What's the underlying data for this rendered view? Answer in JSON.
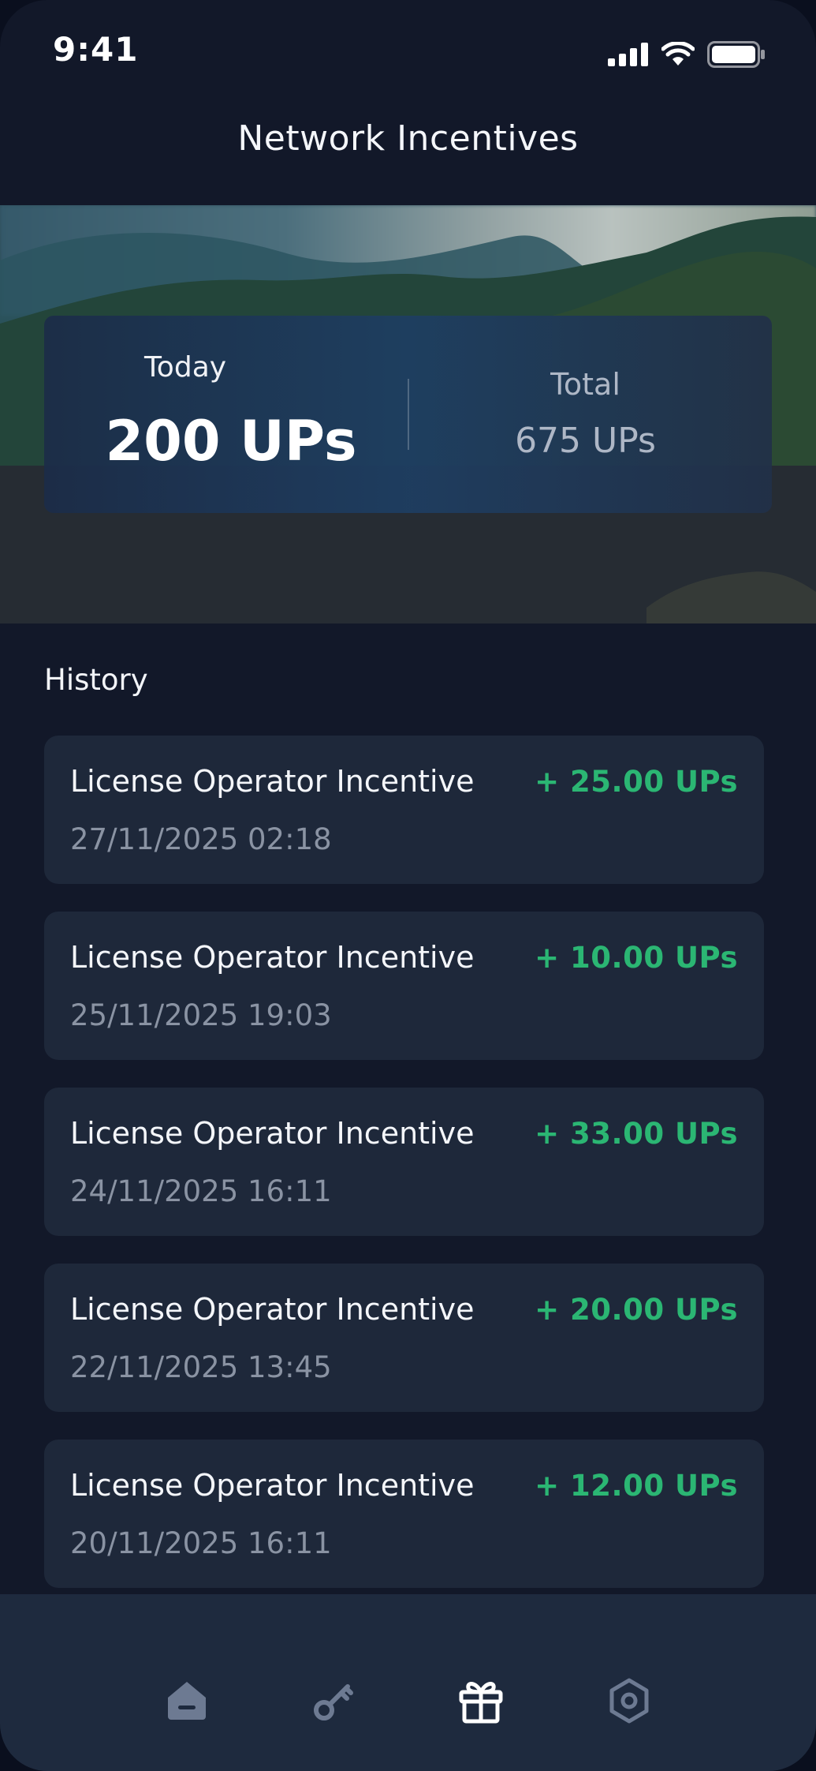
{
  "status_bar": {
    "time": "9:41",
    "icons": [
      "cellular-signal-icon",
      "wifi-icon",
      "battery-icon"
    ]
  },
  "header": {
    "title": "Network Incentives"
  },
  "stats": {
    "today_label": "Today",
    "today_value": "200 UPs",
    "total_label": "Total",
    "total_value": "675 UPs"
  },
  "history": {
    "title": "History",
    "items": [
      {
        "title": "License Operator Incentive",
        "date": "27/11/2025 02:18",
        "amount": "+ 25.00 UPs"
      },
      {
        "title": "License Operator Incentive",
        "date": "25/11/2025 19:03",
        "amount": "+ 10.00 UPs"
      },
      {
        "title": "License Operator Incentive",
        "date": "24/11/2025 16:11",
        "amount": "+ 33.00 UPs"
      },
      {
        "title": "License Operator Incentive",
        "date": "22/11/2025 13:45",
        "amount": "+ 20.00 UPs"
      },
      {
        "title": "License Operator Incentive",
        "date": "20/11/2025 16:11",
        "amount": "+ 12.00 UPs"
      }
    ]
  },
  "bottom_nav": {
    "items": [
      {
        "icon": "home-icon",
        "active": false
      },
      {
        "icon": "key-icon",
        "active": false
      },
      {
        "icon": "gift-icon",
        "active": true
      },
      {
        "icon": "settings-hexagon-icon",
        "active": false
      }
    ]
  },
  "colors": {
    "background": "#121829",
    "card": "#1e283a",
    "accent_green": "#2bb673",
    "muted_text": "#8a93a3",
    "nav_background": "#1e2a3e"
  }
}
